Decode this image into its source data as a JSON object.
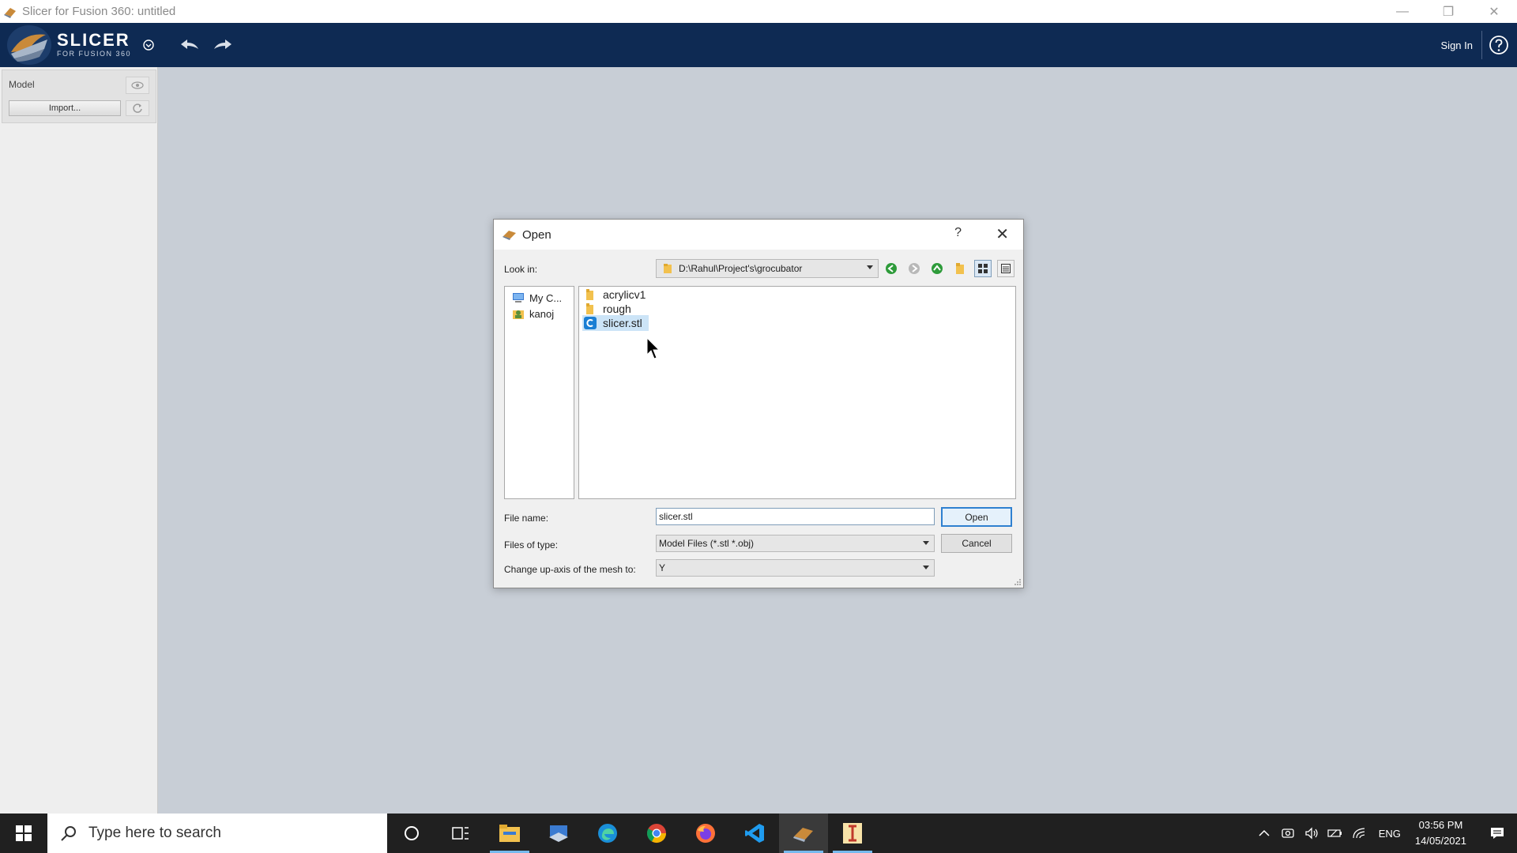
{
  "window": {
    "title": "Slicer for Fusion 360: untitled",
    "minimize_glyph": "—",
    "restore_glyph": "❐",
    "close_glyph": "✕"
  },
  "header": {
    "logo_line1": "SLICER",
    "logo_line2": "FOR FUSION 360",
    "sign_in": "Sign In",
    "colors": {
      "bar": "#0e2a53",
      "text": "#ffffff"
    }
  },
  "left_panel": {
    "model_label": "Model",
    "import_label": "Import..."
  },
  "dialog": {
    "title": "Open",
    "help_glyph": "?",
    "close_glyph": "✕",
    "look_in_label": "Look in:",
    "look_in_value": "D:\\Rahul\\Project's\\grocubator",
    "sidebar": [
      {
        "label": "My C...",
        "icon": "computer-icon"
      },
      {
        "label": "kanoj",
        "icon": "user-folder-icon"
      }
    ],
    "files": [
      {
        "name": "acrylicv1",
        "icon": "folder-icon",
        "selected": false
      },
      {
        "name": "rough",
        "icon": "folder-icon",
        "selected": false
      },
      {
        "name": "slicer.stl",
        "icon": "stl-file-icon",
        "selected": true
      }
    ],
    "file_name_label": "File name:",
    "file_name_value": "slicer.stl",
    "open_label": "Open",
    "files_of_type_label": "Files of type:",
    "files_of_type_value": "Model Files (*.stl *.obj)",
    "cancel_label": "Cancel",
    "up_axis_label": "Change up-axis of the mesh to:",
    "up_axis_value": "Y"
  },
  "taskbar": {
    "search_placeholder": "Type here to search",
    "language": "ENG",
    "time": "03:56 PM",
    "date": "14/05/2021"
  }
}
